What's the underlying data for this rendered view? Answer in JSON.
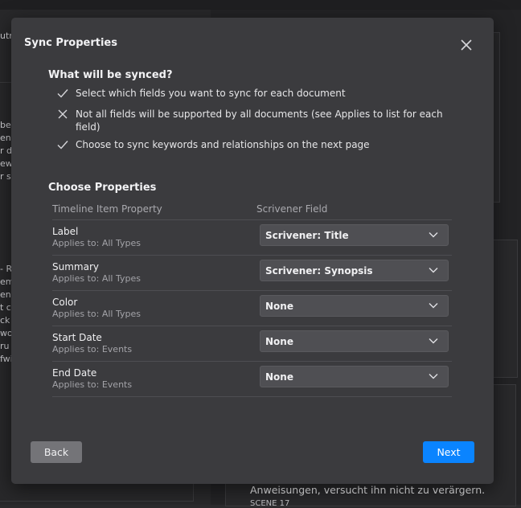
{
  "dialog": {
    "title": "Sync Properties",
    "what_title": "What will be synced?",
    "items": [
      {
        "icon": "check-icon",
        "text": "Select which fields you want to sync for each document"
      },
      {
        "icon": "cross-icon",
        "text": "Not all fields will be supported by all documents (see Applies to list for each field)"
      },
      {
        "icon": "check-icon",
        "text": "Choose to sync keywords and relationships on the next page"
      }
    ],
    "choose_title": "Choose Properties",
    "columns": {
      "timeline": "Timeline Item Property",
      "scrivener": "Scrivener Field"
    },
    "rows": [
      {
        "name": "Label",
        "applies": "Applies to: All Types",
        "value": "Scrivener: Title"
      },
      {
        "name": "Summary",
        "applies": "Applies to: All Types",
        "value": "Scrivener: Synopsis"
      },
      {
        "name": "Color",
        "applies": "Applies to: All Types",
        "value": "None"
      },
      {
        "name": "Start Date",
        "applies": "Applies to: Events",
        "value": "None"
      },
      {
        "name": "End Date",
        "applies": "Applies to: Events",
        "value": "None"
      }
    ],
    "back_label": "Back",
    "next_label": "Next"
  },
  "background": {
    "left_snippets": [
      "utr",
      "be\nen\nr d\new\nr s",
      "- R\nem\nen\nt c\nck :\nwo\nru\nfwi"
    ],
    "right_text": "Anweisungen, versucht ihn nicht zu verärgern.",
    "right_text2": "SCENE 17"
  },
  "colors": {
    "accent": "#0a84ff",
    "dialog_bg": "#3b3b3e",
    "select_bg": "#4f4f53",
    "back_btn": "#747478"
  }
}
